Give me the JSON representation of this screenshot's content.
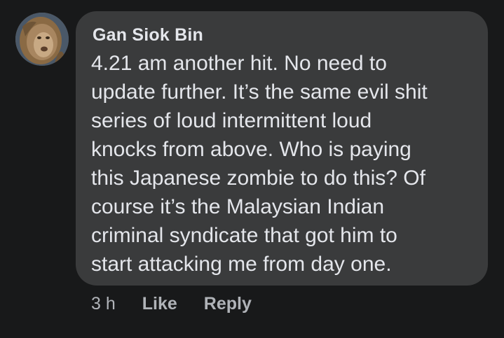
{
  "comment": {
    "author": "Gan Siok Bin",
    "avatar_icon": "lion-avatar",
    "text_lines": [
      "4.21 am another hit. No need to",
      "update further. It’s the same evil shit",
      "series of loud intermittent loud",
      "knocks from above. Who is paying",
      "this Japanese zombie to do this? Of",
      "course it’s the Malaysian Indian",
      "criminal syndicate that got him to",
      "start attacking me from day one."
    ]
  },
  "actions": {
    "time": "3 h",
    "like_label": "Like",
    "reply_label": "Reply"
  },
  "colors": {
    "background": "#18191a",
    "bubble": "#3a3b3c",
    "primary_text": "#e4e6eb",
    "secondary_text": "#b0b3b8"
  }
}
